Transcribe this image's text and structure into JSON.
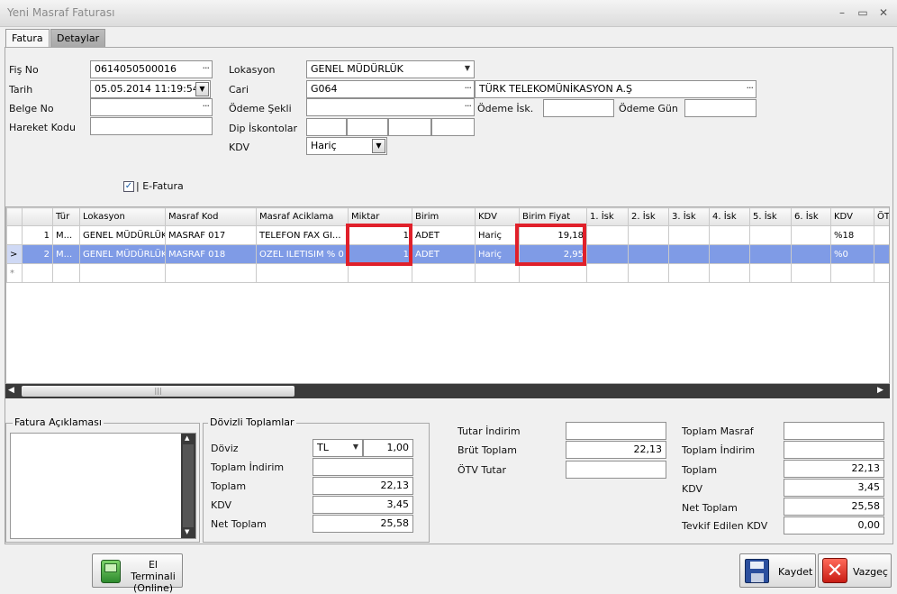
{
  "window": {
    "title": "Yeni Masraf Faturası"
  },
  "tabs": [
    {
      "label": "Fatura"
    },
    {
      "label": "Detaylar"
    }
  ],
  "form": {
    "fis_no_label": "Fiş No",
    "fis_no_value": "0614050500016",
    "tarih_label": "Tarih",
    "tarih_value": "05.05.2014 11:19:54",
    "belge_no_label": "Belge No",
    "belge_no_value": "",
    "hareket_kodu_label": "Hareket Kodu",
    "hareket_kodu_value": "",
    "lokasyon_label": "Lokasyon",
    "lokasyon_value": "GENEL MÜDÜRLÜK",
    "cari_label": "Cari",
    "cari_code": "G064",
    "cari_name": "TÜRK TELEKOMÜNİKASYON A.Ş",
    "odeme_sekli_label": "Ödeme Şekli",
    "odeme_sekli_value": "",
    "odeme_isk_label": "Ödeme İsk.",
    "odeme_gun_label": "Ödeme Gün",
    "dip_iskontolar_label": "Dip İskontolar",
    "kdv_label": "KDV",
    "kdv_value": "Hariç",
    "efatura_label": "E-Fatura",
    "efatura_checked": true
  },
  "grid": {
    "columns": [
      "Tür",
      "Lokasyon",
      "Masraf Kod",
      "Masraf Aciklama",
      "Miktar",
      "Birim",
      "KDV",
      "Birim Fiyat",
      "1. İsk",
      "2. İsk",
      "3. İsk",
      "4. İsk",
      "5. İsk",
      "6. İsk",
      "KDV",
      "ÖTV"
    ],
    "rows": [
      {
        "no": "1",
        "tur": "M...",
        "lokasyon": "GENEL MÜDÜRLÜK",
        "masraf_kod": "MASRAF 017",
        "aciklama": "TELEFON FAX GI...",
        "miktar": "1",
        "birim": "ADET",
        "kdv": "Hariç",
        "birim_fiyat": "19,18",
        "kdv_oran": "%18"
      },
      {
        "no": "2",
        "tur": "M...",
        "lokasyon": "GENEL MÜDÜRLÜK",
        "masraf_kod": "MASRAF 018",
        "aciklama": "OZEL ILETISIM % 0",
        "miktar": "1",
        "birim": "ADET",
        "kdv": "Hariç",
        "birim_fiyat": "2,95",
        "kdv_oran": "%0"
      }
    ],
    "new_row_marker": "*",
    "current_row_marker": ">",
    "scroll_grip": "|||"
  },
  "fatura_aciklamasi": {
    "title": "Fatura Açıklaması",
    "value": ""
  },
  "dovizli": {
    "title": "Dövizli Toplamlar",
    "doviz_label": "Döviz",
    "doviz_value": "TL",
    "kur_value": "1,00",
    "toplam_indirim_label": "Toplam İndirim",
    "toplam_indirim_value": "",
    "toplam_label": "Toplam",
    "toplam_value": "22,13",
    "kdv_label": "KDV",
    "kdv_value": "3,45",
    "net_toplam_label": "Net Toplam",
    "net_toplam_value": "25,58"
  },
  "middle_totals": {
    "tutar_indirim_label": "Tutar İndirim",
    "tutar_indirim_value": "",
    "brut_toplam_label": "Brüt Toplam",
    "brut_toplam_value": "22,13",
    "otv_tutar_label": "ÖTV Tutar",
    "otv_tutar_value": ""
  },
  "right_totals": {
    "toplam_masraf_label": "Toplam Masraf",
    "toplam_masraf_value": "",
    "toplam_indirim_label": "Toplam İndirim",
    "toplam_indirim_value": "",
    "toplam_label": "Toplam",
    "toplam_value": "22,13",
    "kdv_label": "KDV",
    "kdv_value": "3,45",
    "net_toplam_label": "Net Toplam",
    "net_toplam_value": "25,58",
    "tevkif_label": "Tevkif Edilen KDV",
    "tevkif_value": "0,00"
  },
  "buttons": {
    "el_terminali_line1": "El Terminali",
    "el_terminali_line2": "(Online)",
    "kaydet": "Kaydet",
    "vazgec": "Vazgeç"
  },
  "icons": {
    "minimize": "minimize-icon",
    "maximize": "maximize-icon",
    "close": "close-icon",
    "terminal": "handheld-terminal-icon",
    "save": "floppy-disk-icon",
    "cancel": "red-x-icon"
  },
  "colors": {
    "selected_row": "#7f9be6",
    "highlight_box": "#e0202a",
    "titlebar_text": "#8a8a8a"
  }
}
